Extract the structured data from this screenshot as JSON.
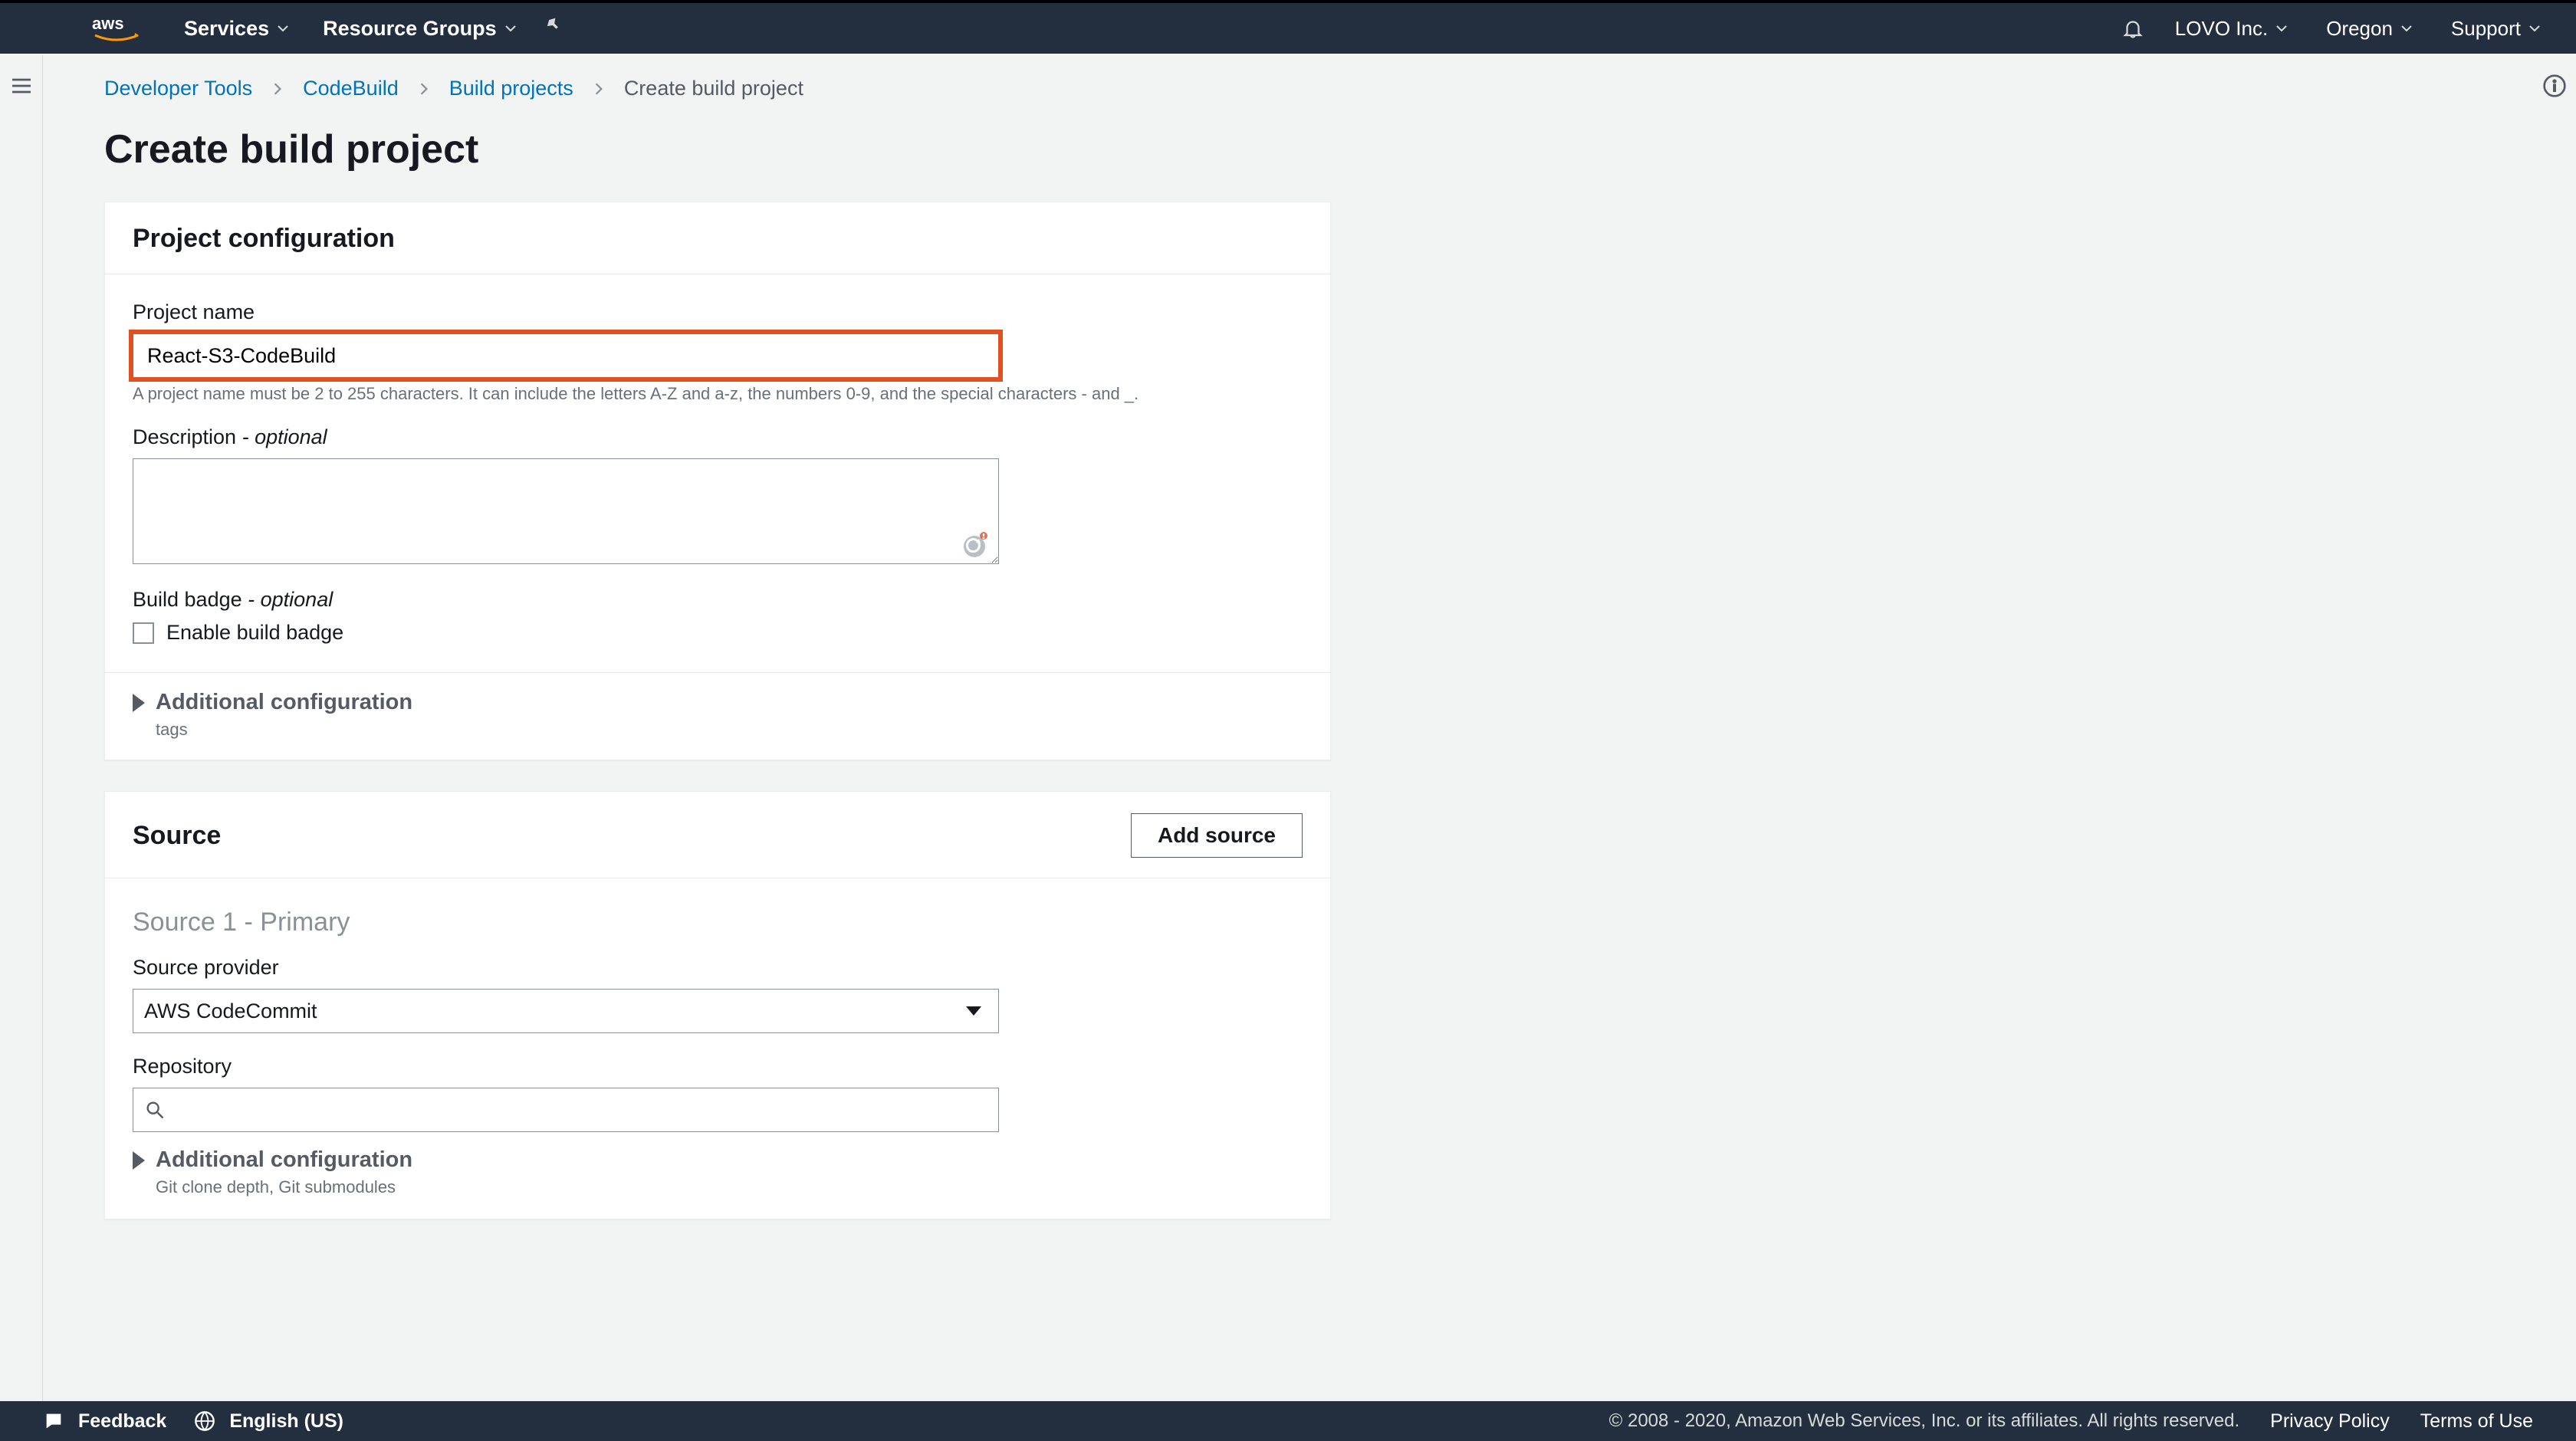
{
  "nav": {
    "services": "Services",
    "resource_groups": "Resource Groups",
    "account": "LOVO Inc.",
    "region": "Oregon",
    "support": "Support"
  },
  "breadcrumb": {
    "a": "Developer Tools",
    "b": "CodeBuild",
    "c": "Build projects",
    "current": "Create build project"
  },
  "page_title": "Create build project",
  "project_config": {
    "title": "Project configuration",
    "name_label": "Project name",
    "name_value": "React-S3-CodeBuild",
    "name_hint": "A project name must be 2 to 255 characters. It can include the letters A-Z and a-z, the numbers 0-9, and the special characters - and _.",
    "desc_label": "Description",
    "desc_opt": "- optional",
    "desc_value": "",
    "badge_label": "Build badge",
    "badge_opt": "- optional",
    "badge_checkbox": "Enable build badge",
    "addl_title": "Additional configuration",
    "addl_sub": "tags"
  },
  "source": {
    "title": "Source",
    "add_btn": "Add source",
    "sub_title": "Source 1 - Primary",
    "provider_label": "Source provider",
    "provider_value": "AWS CodeCommit",
    "repo_label": "Repository",
    "repo_value": "",
    "addl_title": "Additional configuration",
    "addl_sub": "Git clone depth, Git submodules"
  },
  "footer": {
    "feedback": "Feedback",
    "language": "English (US)",
    "copyright": "© 2008 - 2020, Amazon Web Services, Inc. or its affiliates. All rights reserved.",
    "privacy": "Privacy Policy",
    "terms": "Terms of Use"
  }
}
